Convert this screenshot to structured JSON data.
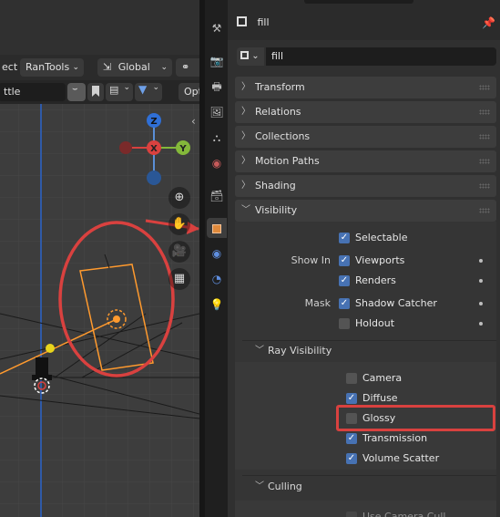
{
  "viewport": {
    "select_label": "ect",
    "ran_tools_label": "RanTools",
    "orientation_label": "Global",
    "options_label": "Opt",
    "search_value": "ttle",
    "gizmo": {
      "z_label": "Z",
      "y_label": "Y"
    }
  },
  "properties": {
    "object_title": "fill",
    "name_field_value": "fill",
    "panels": {
      "transform": "Transform",
      "relations": "Relations",
      "collections": "Collections",
      "motion_paths": "Motion Paths",
      "shading": "Shading",
      "visibility": "Visibility",
      "culling": "Culling"
    },
    "visibility": {
      "selectable": {
        "label": "Selectable",
        "checked": true
      },
      "show_in_label": "Show In",
      "viewports": {
        "label": "Viewports",
        "checked": true
      },
      "renders": {
        "label": "Renders",
        "checked": true
      },
      "mask_label": "Mask",
      "shadow_catcher": {
        "label": "Shadow Catcher",
        "checked": true
      },
      "holdout": {
        "label": "Holdout",
        "checked": false
      },
      "ray_visibility_label": "Ray Visibility",
      "ray": {
        "camera": {
          "label": "Camera",
          "checked": false
        },
        "diffuse": {
          "label": "Diffuse",
          "checked": true
        },
        "glossy": {
          "label": "Glossy",
          "checked": false
        },
        "transmission": {
          "label": "Transmission",
          "checked": true
        },
        "volume_scatter": {
          "label": "Volume Scatter",
          "checked": true
        }
      }
    },
    "culling": {
      "use_camera_cull": {
        "label": "Use Camera Cull",
        "checked": false
      }
    }
  },
  "colors": {
    "accent_blue": "#4772b3",
    "annotation_red": "#d9413f",
    "active_tab_orange": "#e08a3c",
    "selection_orange": "#ff9a2e"
  },
  "icons": {
    "tabs": [
      "tool-icon",
      "render-icon",
      "output-icon",
      "view-layer-icon",
      "scene-icon",
      "world-icon",
      "collection-icon",
      "object-icon",
      "modifier-icon",
      "particles-icon",
      "physics-icon",
      "constraints-icon"
    ]
  }
}
